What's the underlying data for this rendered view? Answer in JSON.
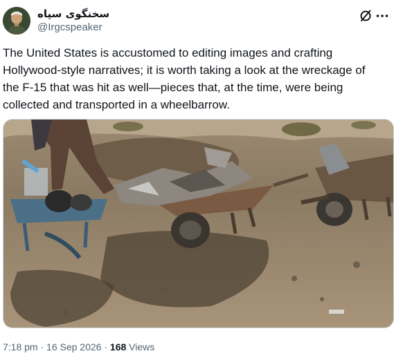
{
  "account": {
    "display_name": "سخنگوی سپاه",
    "handle": "@Irgcspeaker",
    "avatar_icon": "profile-photo"
  },
  "actions": {
    "grok_icon": "grok-icon",
    "more_icon": "more-options-icon"
  },
  "tweet": {
    "text": "The United States is accustomed to editing images and crafting\nHollywood-style narratives; it is worth taking a look at the wreckage of\nthe F-15 that was hit as well—pieces that, at the time, were being\ncollected and transported in a wheelbarrow."
  },
  "media": {
    "type": "photo"
  },
  "meta": {
    "time": "7:18 pm",
    "separator": "·",
    "date": "16 Sep 2026",
    "views_count": "168",
    "views_label": "Views"
  },
  "colors": {
    "text": "#0f1419",
    "secondary": "#536471",
    "border": "#cfd9de"
  }
}
